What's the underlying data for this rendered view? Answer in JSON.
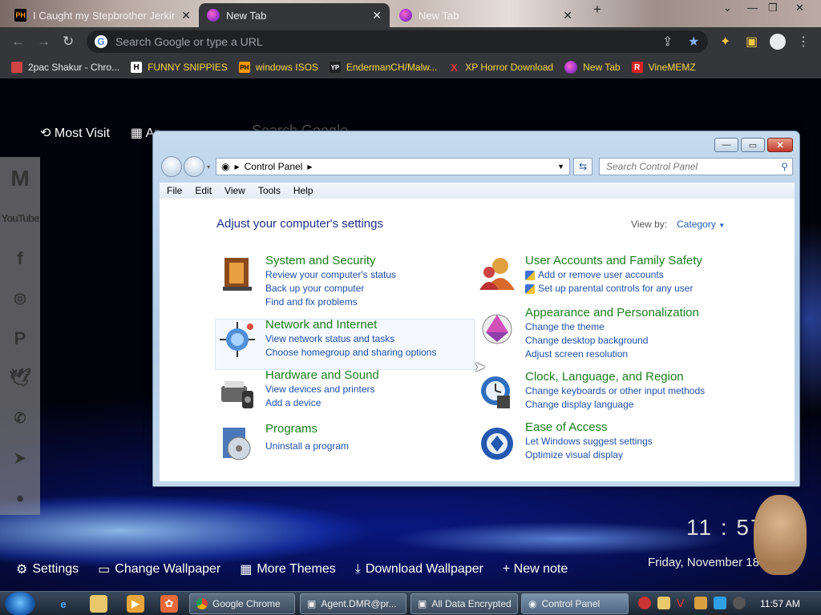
{
  "browser": {
    "tabs": [
      {
        "title": "I Caught my Stepbrother Jerking",
        "favicon": "PH"
      },
      {
        "title": "New Tab",
        "active": true
      },
      {
        "title": "New Tab"
      }
    ],
    "new_tab_symbol": "+",
    "omnibox_placeholder": "Search Google or type a URL",
    "google_letter": "G",
    "bookmarks": [
      {
        "label": "2pac Shakur - Chro...",
        "icon": "P"
      },
      {
        "label": "FUNNY SNIPPIES",
        "icon": "H"
      },
      {
        "label": "windows ISOS",
        "icon": "PH"
      },
      {
        "label": "EndermanCH/Malw...",
        "icon": "YP"
      },
      {
        "label": "XP Horror Download",
        "icon": "X"
      },
      {
        "label": "New Tab",
        "icon": "globe"
      },
      {
        "label": "VineMEMZ",
        "icon": "R"
      }
    ]
  },
  "ntp": {
    "top_links": [
      "Most Visit",
      "Ap"
    ],
    "search_placeholder": "Search Google",
    "social": [
      "M",
      "YouTube",
      "f",
      "ig",
      "P",
      "tw",
      "wa",
      "tg",
      "rd"
    ],
    "clock": "11 : 57",
    "date": "Friday, November 18",
    "bottom": [
      "Settings",
      "Change Wallpaper",
      "More Themes",
      "Download Wallpaper",
      "+ New note"
    ]
  },
  "control_panel": {
    "address": "Control Panel",
    "search_placeholder": "Search Control Panel",
    "menu": [
      "File",
      "Edit",
      "View",
      "Tools",
      "Help"
    ],
    "heading": "Adjust your computer's settings",
    "view_by_label": "View by:",
    "view_by_value": "Category",
    "categories_left": [
      {
        "title": "System and Security",
        "links": [
          "Review your computer's status",
          "Back up your computer",
          "Find and fix problems"
        ]
      },
      {
        "title": "Network and Internet",
        "links": [
          "View network status and tasks",
          "Choose homegroup and sharing options"
        ]
      },
      {
        "title": "Hardware and Sound",
        "links": [
          "View devices and printers",
          "Add a device"
        ]
      },
      {
        "title": "Programs",
        "links": [
          "Uninstall a program"
        ]
      }
    ],
    "categories_right": [
      {
        "title": "User Accounts and Family Safety",
        "links": [
          "Add or remove user accounts",
          "Set up parental controls for any user"
        ]
      },
      {
        "title": "Appearance and Personalization",
        "links": [
          "Change the theme",
          "Change desktop background",
          "Adjust screen resolution"
        ]
      },
      {
        "title": "Clock, Language, and Region",
        "links": [
          "Change keyboards or other input methods",
          "Change display language"
        ]
      },
      {
        "title": "Ease of Access",
        "links": [
          "Let Windows suggest settings",
          "Optimize visual display"
        ]
      }
    ]
  },
  "taskbar": {
    "tasks": [
      "Google Chrome",
      "Agent.DMR@pr...",
      "All Data Encrypted",
      "Control Panel"
    ],
    "time": "11:57 AM"
  }
}
